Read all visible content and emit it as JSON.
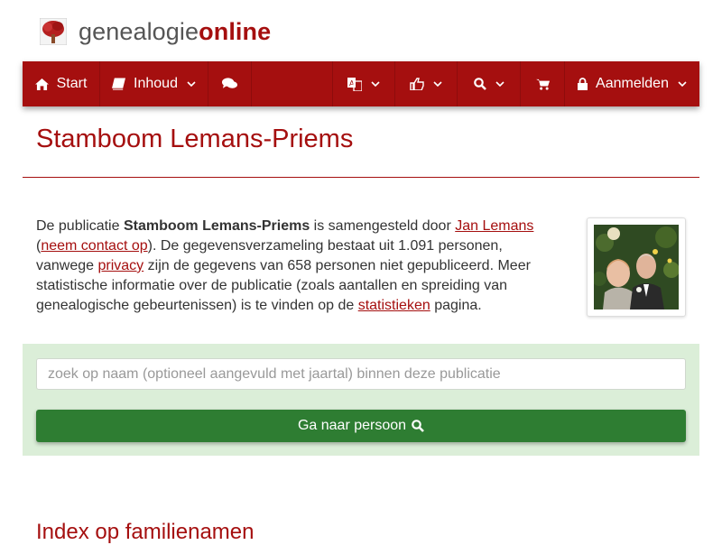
{
  "brand": {
    "name_prefix": "genealogie",
    "name_suffix": "online",
    "logo_icon": "tree-icon"
  },
  "nav": {
    "start_label": "Start",
    "inhoud_label": "Inhoud",
    "login_label": "Aanmelden",
    "icons": [
      "home-icon",
      "book-icon",
      "comments-icon",
      "language-icon",
      "thumbs-up-icon",
      "search-icon",
      "cart-icon",
      "lock-icon",
      "chevron-down-icon"
    ]
  },
  "page": {
    "title": "Stamboom Lemans-Priems"
  },
  "intro": {
    "t1": "De publicatie ",
    "publication": "Stamboom Lemans-Priems",
    "t2": " is samengesteld door ",
    "author": "Jan Lemans",
    "t3": " (",
    "contact": "neem contact op",
    "t4": "). De gegevensverzameling bestaat uit 1.091 personen, vanwege ",
    "privacy": "privacy",
    "t5": " zijn de gegevens van 658 personen niet gepubliceerd. Meer statistische informatie over de publicatie (zoals aantallen en spreiding van genealogische gebeurtenissen) is te vinden op de ",
    "stats": "statistieken",
    "t6": " pagina."
  },
  "search": {
    "placeholder": "zoek op naam (optioneel aangevuld met jaartal) binnen deze publicatie",
    "value": "",
    "button_label": "Ga naar persoon"
  },
  "section": {
    "heading": "Index op familienamen"
  },
  "colors": {
    "brand": "#a50f0f",
    "search_panel": "#dbeed8",
    "button": "#2e7d32"
  }
}
